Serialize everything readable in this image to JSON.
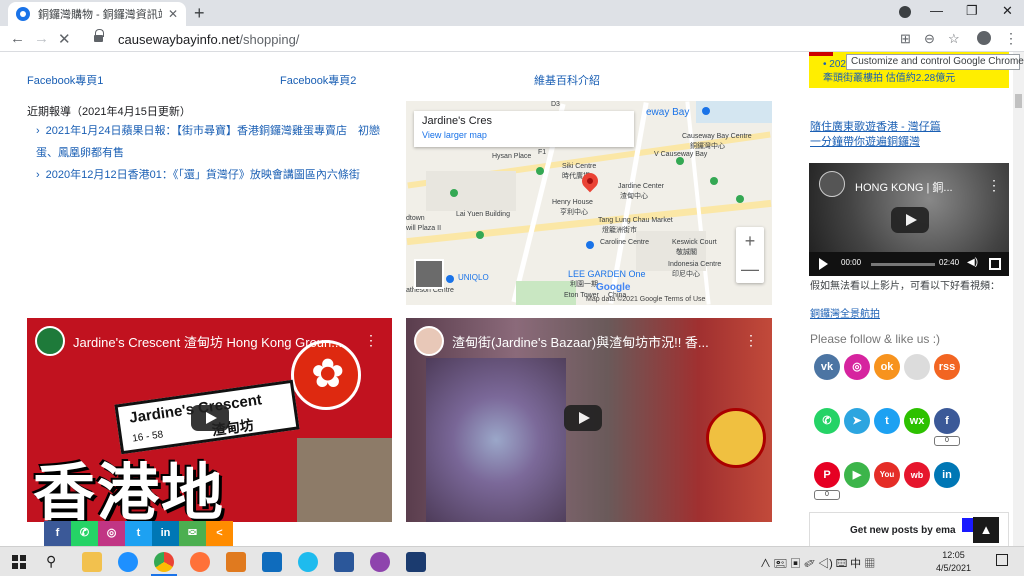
{
  "browser": {
    "tab_title": "銅鑼灣購物 - 銅鑼灣資訊站",
    "tab_close": "✕",
    "new_tab": "+",
    "url_host": "causewaybayinfo.net",
    "url_path": "/shopping/",
    "tooltip": "Customize and control Google Chrome",
    "win_min": "—",
    "win_restore": "❐",
    "win_close": "✕",
    "back": "←",
    "forward": "→",
    "reload": "✕",
    "translate": "⊞",
    "zoom": "⊖",
    "star": "☆",
    "kebab": "⋮"
  },
  "page": {
    "fb1": "Facebook專頁1",
    "fb2": "Facebook專頁2",
    "wiki": "維基百科介紹",
    "news_heading": "近期報導（2021年4月15日更新）",
    "news": [
      "2021年1月24日蘋果日報：【街市尋寶】香港銅鑼灣雞蛋專賣店　初戀蛋、鳳凰卵都有售",
      "2020年12月12日香港01：《「還」貨灣仔》放映會講圖區內六條街"
    ],
    "map": {
      "title": "Jardine's Cres",
      "link": "View larger map",
      "labels": {
        "way_bay": "eway Bay",
        "cwb_centre": "Causeway Bay Centre",
        "cwb_centre_zh": "銅鑼灣中心",
        "v_causeway": "V Causeway Bay",
        "hysan": "Hysan Place",
        "siki": "Siki Centre",
        "siki_zh": "時代廣場",
        "jardine_centre": "Jardine Center",
        "jardine_zh": "渣甸中心",
        "henry": "Henry House",
        "henry_zh": "亨利中心",
        "town": "dtown",
        "will_plaza": "will Plaza II",
        "lai_yuen": "Lai Yuen Building",
        "tang_lung": "Tang Lung Chau Market",
        "tang_lung_zh": "燈籠洲街市",
        "caroline": "Caroline Centre",
        "keswick": "Keswick Court",
        "keswick_zh": "敬誠閣",
        "indonesia": "Indonesia Centre",
        "indonesia_zh": "印尼中心",
        "uniqlo": "UNIQLO",
        "lee_garden": "LEE GARDEN One",
        "lee_garden_zh": "利園一期",
        "eton": "Eton Tower",
        "china": "China",
        "atheson": "atheson Centre",
        "d3": "D3",
        "f1": "F1"
      },
      "zoom_in": "+",
      "zoom_out": "—",
      "google": "Google",
      "footer": "Map data ©2021 Google    Terms of Use"
    },
    "video1": {
      "title": "Jardine's Crescent 渣甸坊 Hong Kong Groun...",
      "sign": "Jardine's Crescent",
      "sign_num": "16 - 58",
      "sign_zh": "渣甸坊",
      "big": "香港地"
    },
    "video2": {
      "title": "渣甸街(Jardine's Bazaar)與渣甸坊市況!! 香..."
    },
    "share_icons": [
      "f",
      "✆",
      "◎",
      "t",
      "in",
      "✉",
      "<"
    ]
  },
  "sidebar": {
    "yellow_lines": [
      "• 2021",
      "牽頭街叢樓拍 估值約2.28億元"
    ],
    "promo_line1": "隨住廣東歌遊香港 - 灣仔篇",
    "promo_line2": "一分鐘帶你遊遍銅鑼灣",
    "video_title": "HONG KONG | 銅...",
    "time_current": "00:00",
    "time_total": "02:40",
    "fallback_text": "假如無法看以上影片，可看以下好看視頻：",
    "fallback_link": "銅鑼灣全景航拍",
    "follow": "Please follow & like us :)",
    "social_row1": [
      "vk",
      "◎",
      "ok",
      "",
      "rss"
    ],
    "social_row2": [
      "✆",
      "➤",
      "t",
      "wx",
      "f"
    ],
    "social_row3": [
      "P",
      "▶",
      "You",
      "wb",
      "in"
    ],
    "counts": [
      "0",
      "0"
    ],
    "subscribe": "Get new posts by ema",
    "totop": "▲"
  },
  "taskbar": {
    "tray": "∧ 🖭 ▣ ✐ ◁) ⌨ 中 ▦",
    "time": "12:05",
    "date": "4/5/2021"
  },
  "colors": {
    "link": "#1a5fb4",
    "yellow": "#ffee00",
    "video_red": "#c1121f"
  }
}
